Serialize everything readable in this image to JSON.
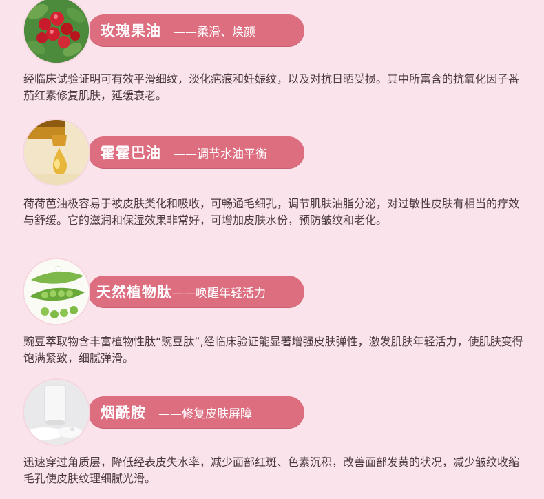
{
  "sections": [
    {
      "name": "玫瑰果油",
      "benefit": "——柔滑、焕颜",
      "description": "经临床试验证明可有效平滑细纹，淡化疤痕和妊娠纹，以及对抗日晒受损。其中所富含的抗氧化因子番茄红素修复肌肤，延缓衰老。",
      "icon": "rosehip-berries-icon"
    },
    {
      "name": "霍霍巴油",
      "benefit": "——调节水油平衡",
      "description": "荷荷芭油极容易于被皮肤类化和吸收，可畅通毛细孔，调节肌肤油脂分泌，对过敏性皮肤有相当的疗效与舒缓。它的滋润和保湿效果非常好，可增加皮肤水份，预防皱纹和老化。",
      "icon": "oil-drop-icon"
    },
    {
      "name": "天然植物肽",
      "benefit": "——唤醒年轻活力",
      "description": "豌豆萃取物含丰富植物性肽“豌豆肽”,经临床验证能显著增强皮肤弹性，激发肌肤年轻活力，使肌肤变得饱满紧致，细腻弹滑。",
      "icon": "pea-pods-icon"
    },
    {
      "name": "烟酰胺",
      "benefit": "——修复皮肤屏障",
      "description": "迅速穿过角质层，降低经表皮失水率，减少面部红斑、色素沉积，改善面部发黄的状况，减少皱纹收缩毛孔使皮肤纹理细腻光滑。",
      "icon": "white-powder-icon"
    }
  ]
}
